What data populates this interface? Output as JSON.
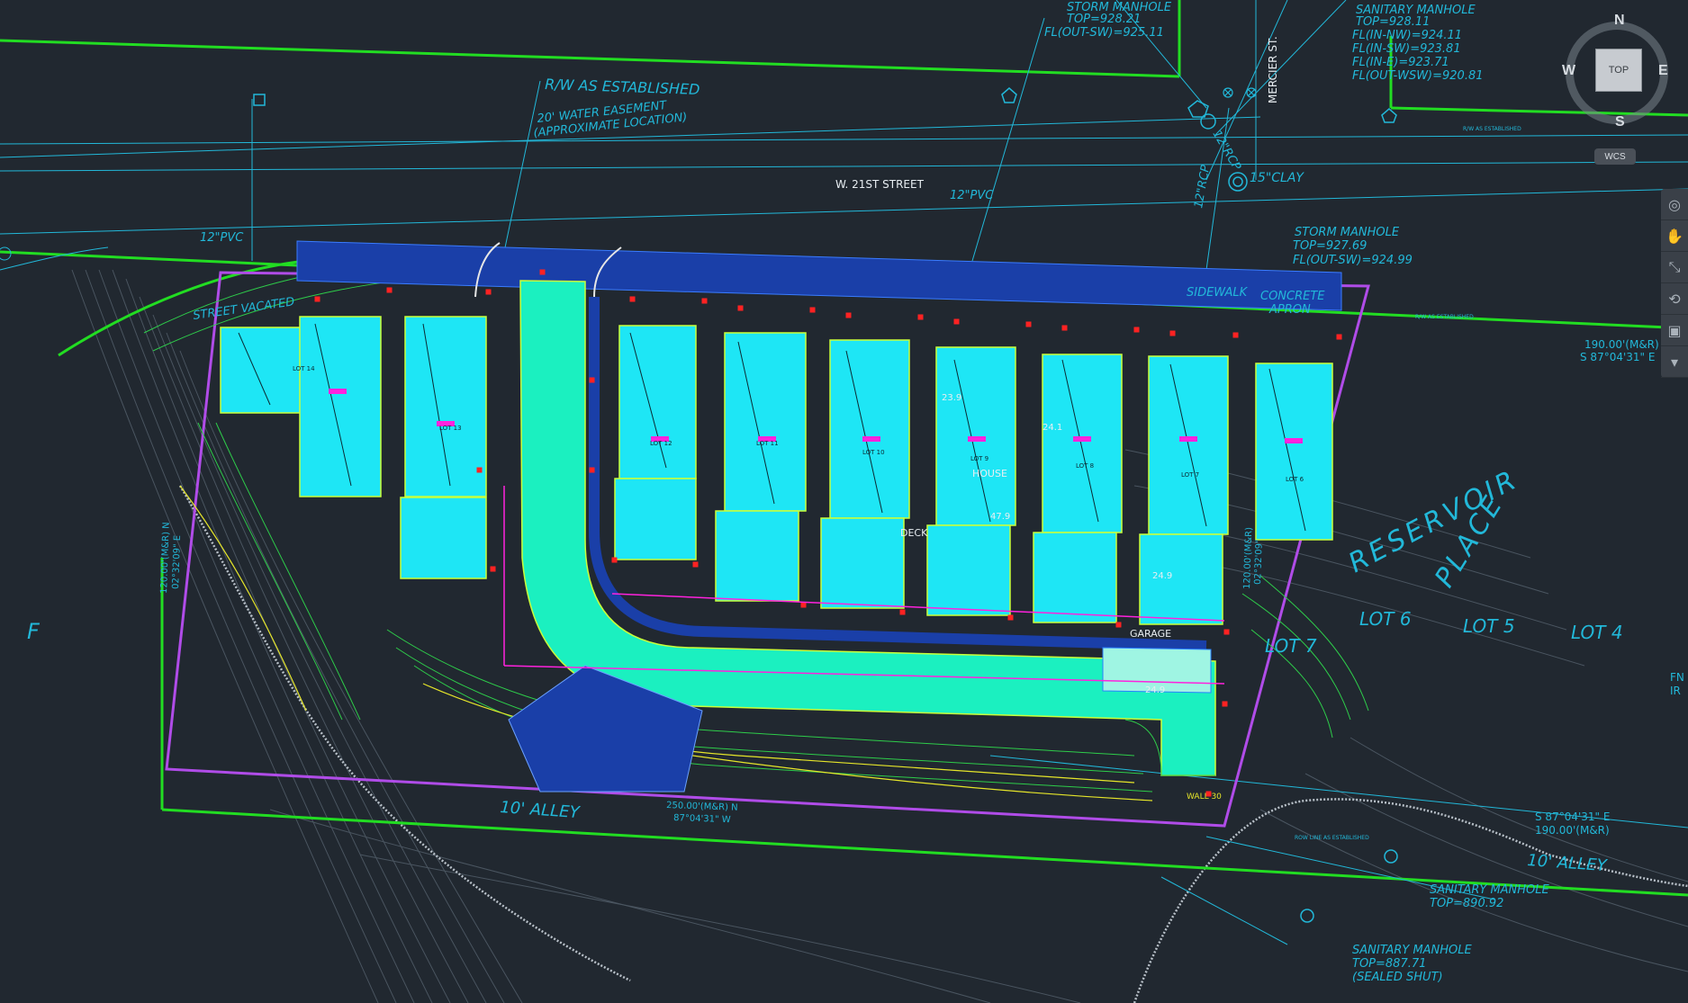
{
  "drawing": {
    "street_name": "W. 21ST STREET",
    "cross_street": "MERCIER ST.",
    "row_established": "R/W AS ESTABLISHED",
    "row_established_small": "R/W AS ESTABLISHED",
    "water_easement": [
      "20' WATER EASEMENT",
      "(APPROXIMATE LOCATION)"
    ],
    "pipe_12_pvc_left": "12\"PVC",
    "pipe_12_pvc_mid": "12\"PVC",
    "pipe_15_clay": "15\"CLAY",
    "pipe_12_rcp_top": "12\"RCP",
    "pipe_12_rcp_low": "12\"RCP",
    "street_vacated": "STREET VACATED",
    "storm_manhole_1": [
      "STORM MANHOLE",
      "TOP=928.21",
      "FL(OUT-SW)=925.11"
    ],
    "sanitary_manhole_1": [
      "SANITARY MANHOLE",
      "TOP=928.11",
      "FL(IN-NW)=924.11",
      "FL(IN-SW)=923.81",
      "FL(IN-E)=923.71",
      "FL(OUT-WSW)=920.81"
    ],
    "storm_manhole_2": [
      "STORM MANHOLE",
      "TOP=927.69",
      "FL(OUT-SW)=924.99"
    ],
    "sanitary_manhole_2": [
      "SANITARY MANHOLE",
      "TOP=890.92"
    ],
    "sanitary_manhole_3": [
      "SANITARY MANHOLE",
      "TOP=887.71",
      "(SEALED SHUT)"
    ],
    "sidewalk": "SIDEWALK",
    "concrete_apron": [
      "CONCRETE",
      "APRON"
    ],
    "reservoir": "RESERVOIR",
    "place": "PLACE",
    "lot_labels_right": [
      "LOT 7",
      "LOT 6",
      "LOT 5",
      "LOT 4"
    ],
    "alley_bottom": "10' ALLEY",
    "alley_right": "10' ALLEY",
    "bearing_bottom": [
      "250.00'(M&R) N",
      "87°04'31\" W"
    ],
    "bearing_left": [
      "120.00'(M&R) N",
      "02°32'09\" E"
    ],
    "bearing_right_col": [
      "120.00'(M&R)",
      "02°32'09\""
    ],
    "bearing_top_right": [
      "190.00'(M&R)",
      "S 87°04'31\" E"
    ],
    "bearing_bottom_right": [
      "S 87°04'31\" E",
      "190.00'(M&R)"
    ],
    "row_bottom": "ROW LINE AS ESTABLISHED",
    "row_right_small": "R/W AS ESTABLISHED",
    "edge_fn": "FN",
    "edge_ir": "IR",
    "edge_f": "F",
    "lots": [
      "LOT 14",
      "LOT 13",
      "LOT 12",
      "LOT 11",
      "LOT 10",
      "LOT 9",
      "LOT 8",
      "LOT 7",
      "LOT 6",
      "LOT 5"
    ],
    "spot_elev": [
      "23.9",
      "24.1",
      "24.9",
      "24.9",
      "47.9"
    ],
    "garage": "GARAGE",
    "deck": "DECK",
    "house": "HOUSE",
    "wall": "WALL 30"
  },
  "viewcube": {
    "north": "N",
    "south": "S",
    "east": "E",
    "west": "W",
    "top": "TOP",
    "wcs": "WCS"
  },
  "colors": {
    "background": "#212830",
    "row_line": "#22dd22",
    "cyan_lines": "#22b8d9",
    "lot_fill": "#1ee6f5",
    "drive_fill": "#1bf0c0",
    "paving": "#1a3fa8",
    "boundary": "#b04ce8",
    "red_marks": "#ff2222",
    "magenta": "#ff22dd",
    "yellow": "#e6e62a"
  }
}
